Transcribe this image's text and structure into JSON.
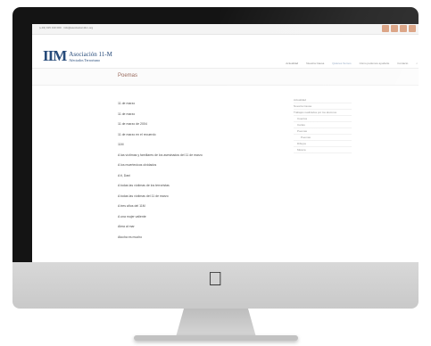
{
  "topbar": {
    "contact": "(+34) 915 130 000 · info@asociacion11m.org"
  },
  "header": {
    "logo_mark": "IIM",
    "logo_line1": "Asociación 11-M",
    "logo_line2": "Afectados Terrorismo",
    "nav": [
      "Actualidad",
      "Nuestra Causa",
      "Quiénes Somos",
      "Cómo podemos ayudarte",
      "Contacto"
    ]
  },
  "page": {
    "title": "Poemas"
  },
  "content": {
    "items": [
      "11 de marzo",
      "11 de marzo",
      "11 de marzo de 2004",
      "11 de marzo en el recuerdo",
      "11M",
      "A las víctimas y familiares de los asesinados del 11 de marzo",
      "A los muertecicos olvidados",
      "A ti, Dani",
      "A todas las víctimas de los terroristas",
      "A todas las víctimas del 11 de marzo",
      "A tres años del 11M",
      "A una mujer valiente",
      "Alma al mar",
      "Atocha es mucho"
    ]
  },
  "sidebar": {
    "items": [
      {
        "label": "Actualidad",
        "level": 0
      },
      {
        "label": "Nuestra Causa",
        "level": 0
      },
      {
        "label": "Trabajos realizados por los alumnos",
        "level": 0
      },
      {
        "label": "Cuentos",
        "level": 1
      },
      {
        "label": "Cartas",
        "level": 1
      },
      {
        "label": "Poemas",
        "level": 1
      },
      {
        "label": "Poemas",
        "level": 2
      },
      {
        "label": "Dibujos",
        "level": 1
      },
      {
        "label": "Música",
        "level": 1
      }
    ]
  }
}
